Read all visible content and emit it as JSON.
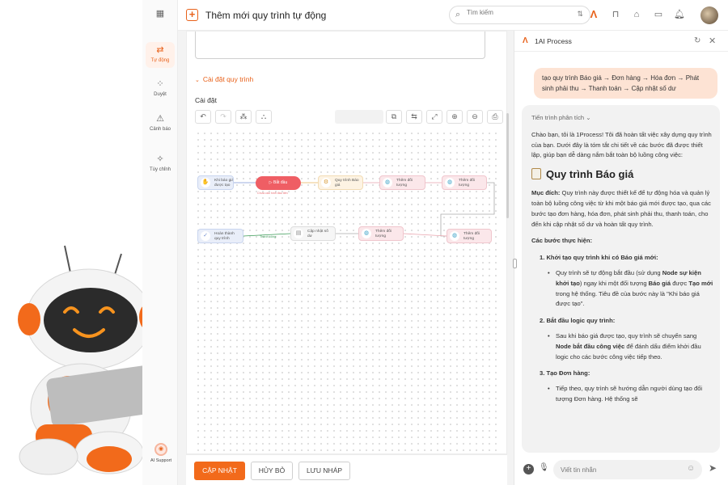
{
  "app": {
    "page_title": "Thêm mới quy trình tự động",
    "search_placeholder": "Tìm kiếm",
    "brand_color": "#f26a1b"
  },
  "rail": {
    "items": [
      {
        "label": "Tự động",
        "icon": "automation-icon",
        "active": true
      },
      {
        "label": "Duyệt",
        "icon": "approve-icon",
        "active": false
      },
      {
        "label": "Cảnh báo",
        "icon": "warning-icon",
        "active": false
      },
      {
        "label": "Tùy chỉnh",
        "icon": "magic-wand-icon",
        "active": false
      }
    ],
    "support_label": "AI Support"
  },
  "editor": {
    "section_title": "Cài đặt quy trình",
    "settings_label": "Cài đặt",
    "flow": {
      "trigger": {
        "line1": "Khi báo giá",
        "line2": "được tạo"
      },
      "start": {
        "label": "Bắt đầu",
        "hint": "Chưa cấu hình đầu tiên"
      },
      "node_quy_trinh_bao_gia": {
        "line1": "Quy trình Báo",
        "line2": "giá"
      },
      "node_them_doi_tuong_1": {
        "line1": "Thêm đối",
        "line2": "tượng"
      },
      "node_them_doi_tuong_2": {
        "line1": "Thêm đối",
        "line2": "tượng"
      },
      "node_them_doi_tuong_3": {
        "line1": "Thêm đối",
        "line2": "tượng"
      },
      "node_them_doi_tuong_4": {
        "line1": "Thêm đối",
        "line2": "tượng"
      },
      "node_cap_nhat_so_du": {
        "line1": "Cập nhật số",
        "line2": "dư"
      },
      "node_hoan_thanh": {
        "line1": "Hoàn thành",
        "line2": "quy trình"
      },
      "edge_label": "Thành công"
    }
  },
  "footer": {
    "save_label": "CẬP NHẬT",
    "cancel_label": "HỦY BỎ",
    "draft_label": "LƯU NHÁP"
  },
  "chat": {
    "title": "1AI Process",
    "user_message": "tạo quy trình Báo giá → Đơn hàng → Hóa đơn → Phát sinh phải thu → Thanh toán → Cập nhật số dư",
    "analysis_toggle": "Tiến trình phân tích",
    "intro": "Chào bạn, tôi là 1Process! Tôi đã hoàn tất việc xây dựng quy trình của bạn. Dưới đây là tóm tắt chi tiết về các bước đã được thiết lập, giúp bạn dễ dàng nắm bắt toàn bộ luồng công việc:",
    "heading": "Quy trình Báo giá",
    "purpose_label": "Mục đích:",
    "purpose_text": " Quy trình này được thiết kế để tự động hóa và quản lý toàn bộ luồng công việc từ khi một báo giá mới được tạo, qua các bước tạo đơn hàng, hóa đơn, phát sinh phải thu, thanh toán, cho đến khi cập nhật số dư và hoàn tất quy trình.",
    "steps_label": "Các bước thực hiện:",
    "step1_title": "1. Khởi tạo quy trình khi có Báo giá mới:",
    "step1_a": "Quy trình sẽ tự động bắt đầu (sử dụng ",
    "step1_b": "Node sự kiện khởi tạo",
    "step1_c": ") ngay khi một đối tượng ",
    "step1_d": "Báo giá",
    "step1_e": " được ",
    "step1_f": "Tạo mới",
    "step1_g": " trong hệ thống. Tiêu đề của bước này là \"Khi báo giá được tạo\".",
    "step2_title": "2. Bắt đầu logic quy trình:",
    "step2_a": "Sau khi báo giá được tạo, quy trình sẽ chuyển sang ",
    "step2_b": "Node bắt đầu công việc",
    "step2_c": " để đánh dấu điểm khởi đầu logic cho các bước công việc tiếp theo.",
    "step3_title": "3. Tạo Đơn hàng:",
    "step3_a": "Tiếp theo, quy trình sẽ hướng dẫn người dùng tạo đối tượng Đơn hàng. Hệ thống sẽ",
    "input_placeholder": "Viết tin nhắn"
  }
}
